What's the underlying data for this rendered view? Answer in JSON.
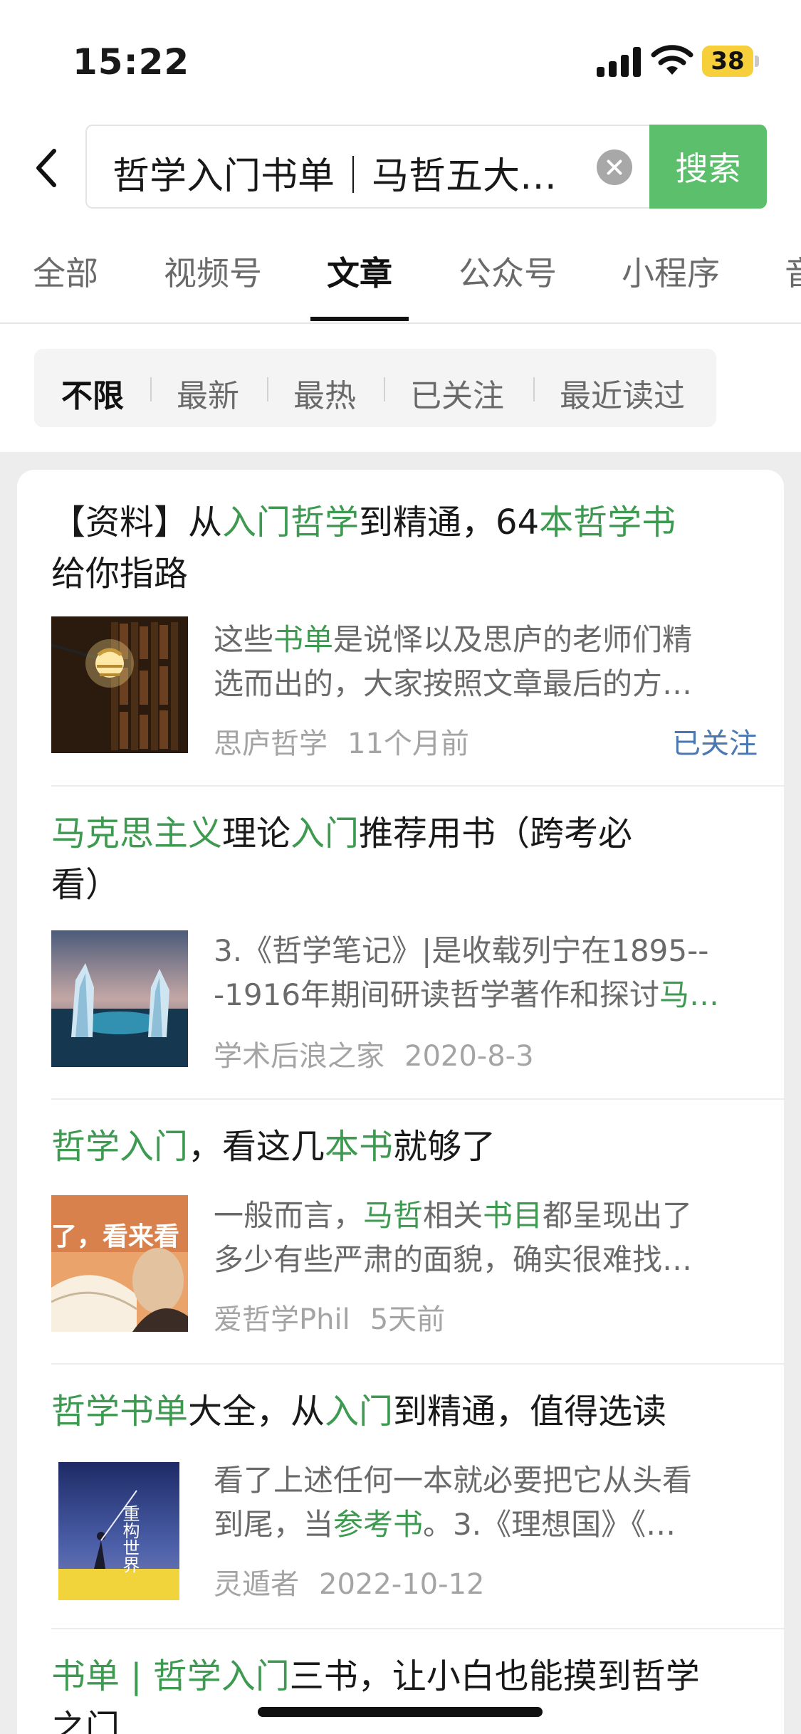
{
  "status_bar": {
    "time": "15:22",
    "battery": "38"
  },
  "search": {
    "query": "哲学入门书单｜马哲五大…",
    "button": "搜索"
  },
  "tabs": [
    {
      "label": "全部"
    },
    {
      "label": "视频号"
    },
    {
      "label": "文章",
      "active": true
    },
    {
      "label": "公众号"
    },
    {
      "label": "小程序"
    },
    {
      "label": "音"
    }
  ],
  "filters": [
    {
      "label": "不限",
      "active": true
    },
    {
      "label": "最新"
    },
    {
      "label": "最热"
    },
    {
      "label": "已关注"
    },
    {
      "label": "最近读过"
    }
  ],
  "colors": {
    "accent_green": "#5bbf6b",
    "highlight_green": "#3e9a51",
    "followed_blue": "#4a78b4"
  },
  "results": [
    {
      "title_1": "【资料】从",
      "title_2": "入门哲学",
      "title_3": "到精通，64",
      "title_4": "本哲学书",
      "title_5": "给你指路",
      "thumb_icon": "lamp-bookshelf-image",
      "snip_1": "这些",
      "snip_2": "书单",
      "snip_3": "是说怿以及思庐的老师们精",
      "snip_line2": "选而出的，大家按照文章最后的方…",
      "source": "思庐哲学",
      "time": "11个月前",
      "followed": "已关注"
    },
    {
      "title_1": "马克思主义",
      "title_2": "理论",
      "title_3": "入门",
      "title_4": "推荐用书（跨考必",
      "title_line2": "看）",
      "thumb_icon": "iceberg-image",
      "snip_line1": "3.《哲学笔记》|是收载列宁在1895--",
      "snip_1": "-1916年期间研读哲学著作和探讨",
      "snip_2": "马…",
      "source": "学术后浪之家",
      "time": "2020-8-3"
    },
    {
      "title_1": "哲学入门",
      "title_2": "，看这几",
      "title_3": "本书",
      "title_4": "就够了",
      "thumb_icon": "book-portrait-image",
      "thumb_text": "了，看来看",
      "snip_1": "一般而言，",
      "snip_2": "马哲",
      "snip_3": "相关",
      "snip_4": "书目",
      "snip_5": "都呈现出了",
      "snip_line2": "多少有些严肃的面貌，确实很难找…",
      "source": "爱哲学Phil",
      "time": "5天前"
    },
    {
      "title_1": "哲学书单",
      "title_2": "大全，从",
      "title_3": "入门",
      "title_4": "到精通，值得选读",
      "thumb_icon": "book-cover-image",
      "thumb_text": "重构世界",
      "snip_line1": "看了上述任何一本就必要把它从头看",
      "snip_1": "到尾，当",
      "snip_2": "参考书",
      "snip_3": "。3.《理想国》《…",
      "source": "灵遁者",
      "time": "2022-10-12"
    },
    {
      "title_1": "书单 | 哲学入门",
      "title_2": "三书，让小白也能摸到哲学",
      "title_line2": "之门"
    }
  ]
}
